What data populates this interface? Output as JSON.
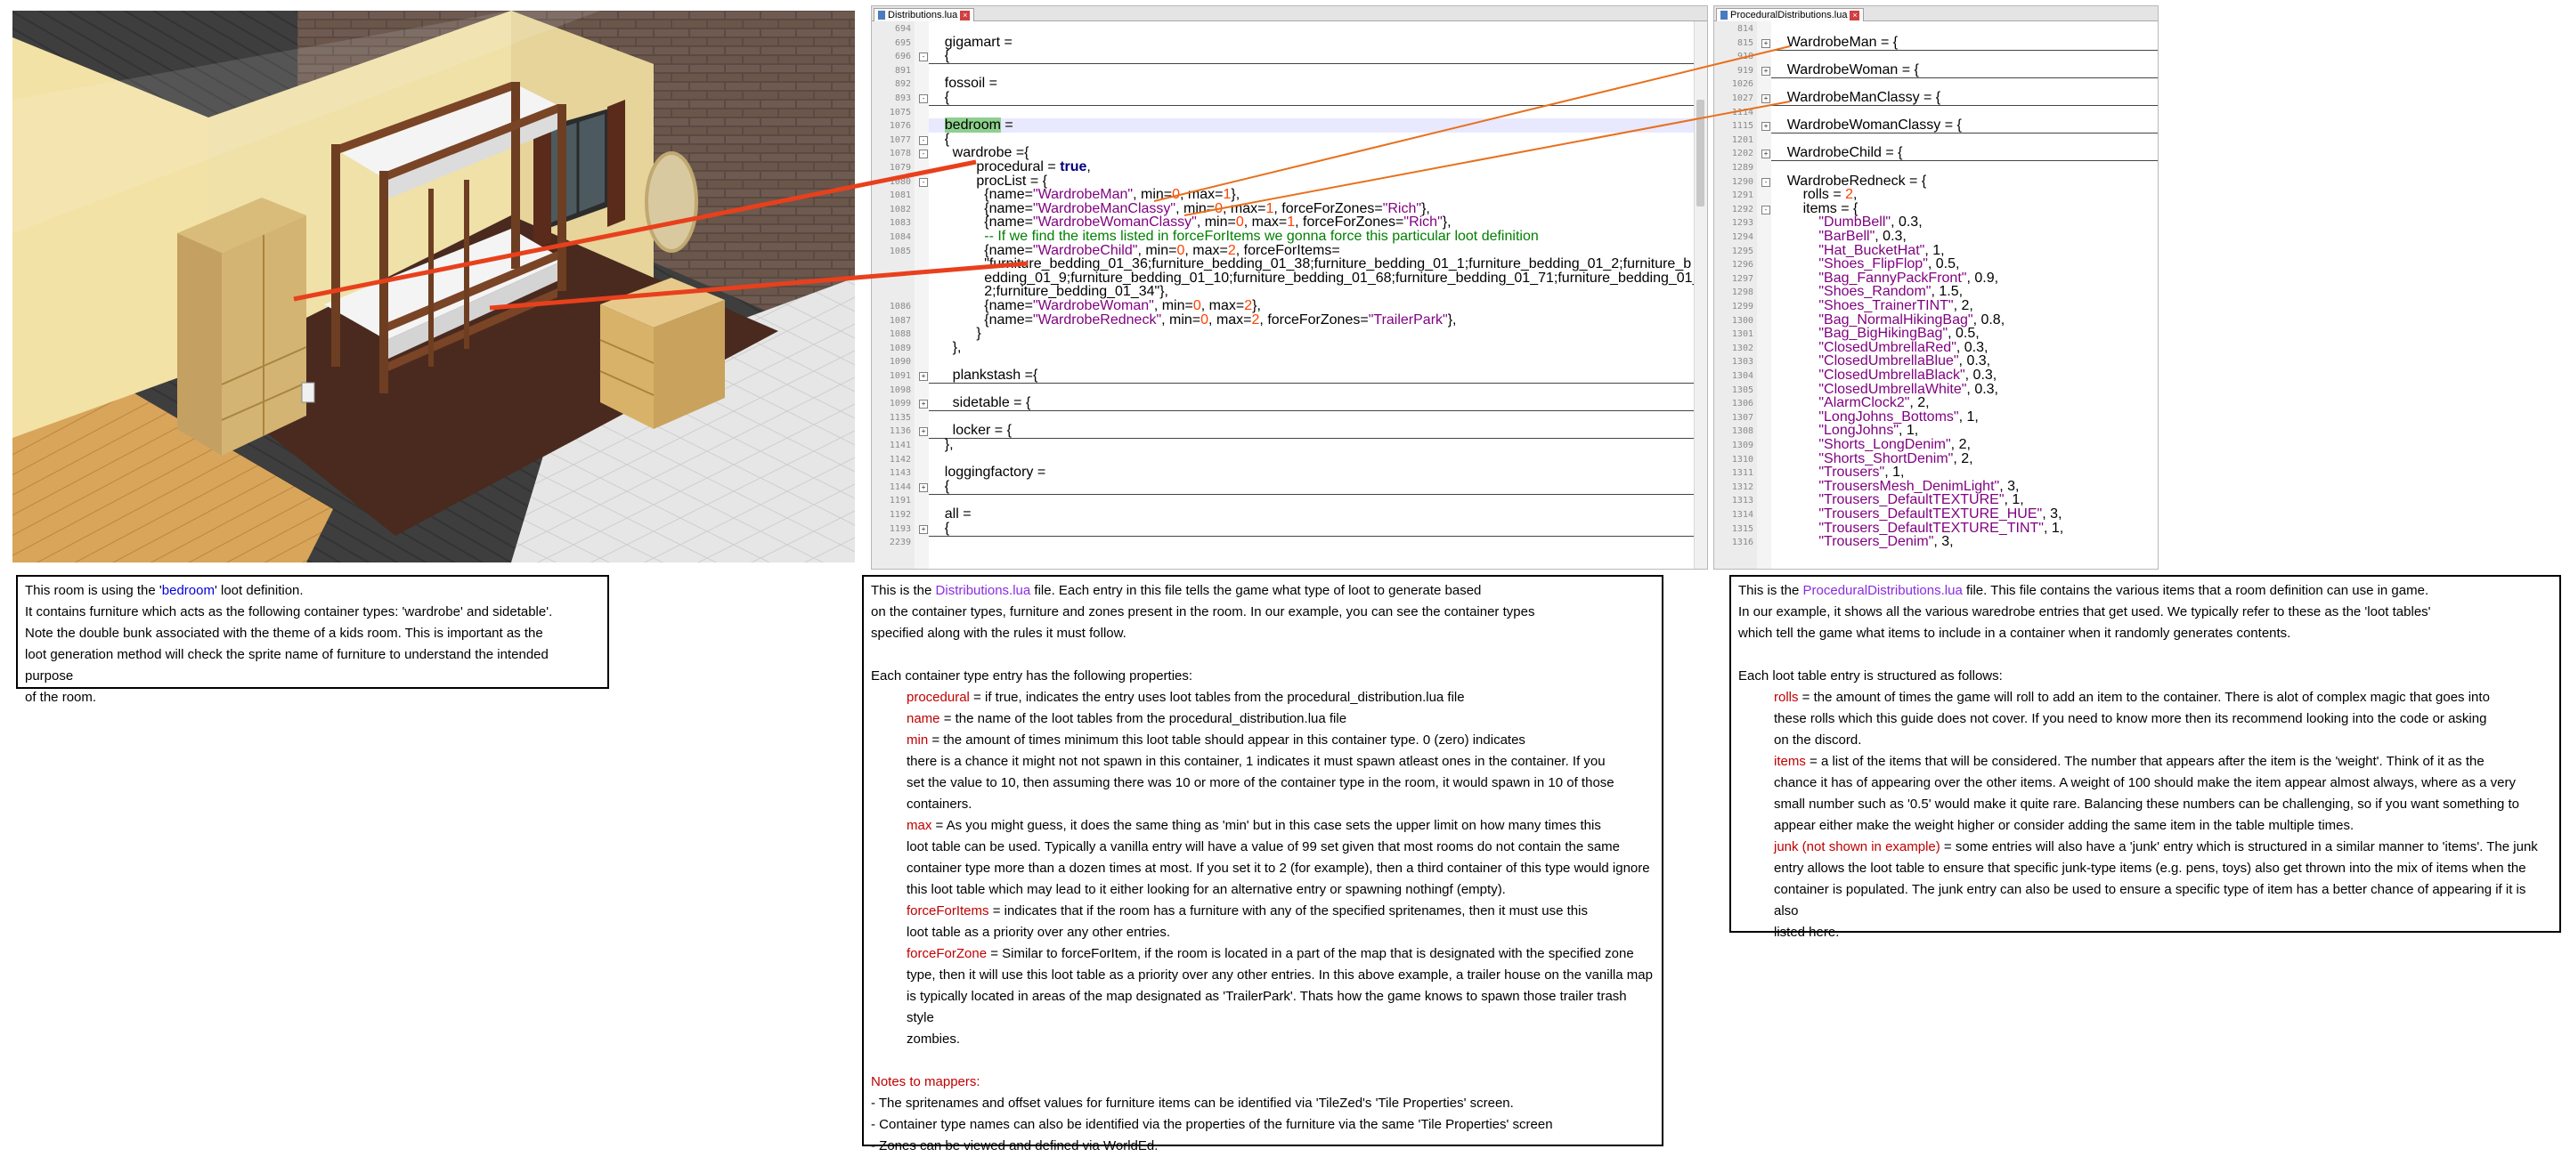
{
  "scene": {
    "name": "kids-bedroom-scene"
  },
  "editor_left": {
    "tab_label": "Distributions.lua",
    "lines": [
      {
        "n": "694",
        "t": ""
      },
      {
        "n": "695",
        "t": "    gigamart ="
      },
      {
        "n": "696",
        "t": "    {",
        "fold": "-",
        "ul": true
      },
      {
        "n": "891",
        "t": ""
      },
      {
        "n": "892",
        "t": "    fossoil ="
      },
      {
        "n": "893",
        "t": "    {",
        "fold": "-",
        "ul": true
      },
      {
        "n": "1075",
        "t": ""
      },
      {
        "n": "1076",
        "t": "    bedroom =",
        "hl": true
      },
      {
        "n": "1077",
        "t": "    {",
        "fold": "-"
      },
      {
        "n": "1078",
        "t": "      wardrobe ={",
        "fold": "-"
      },
      {
        "n": "1079",
        "t": "            procedural = true,"
      },
      {
        "n": "1080",
        "t": "            procList = {",
        "fold": "-"
      },
      {
        "n": "1081",
        "t": "              {name=\"WardrobeMan\", min=0, max=1},"
      },
      {
        "n": "1082",
        "t": "              {name=\"WardrobeManClassy\", min=0, max=1, forceForZones=\"Rich\"},"
      },
      {
        "n": "1083",
        "t": "              {name=\"WardrobeWomanClassy\", min=0, max=1, forceForZones=\"Rich\"},"
      },
      {
        "n": "1084",
        "t": "              -- If we find the items listed in forceForItems we gonna force this particular loot definition"
      },
      {
        "n": "1085",
        "t": "              {name=\"WardrobeChild\", min=0, max=2, forceForItems="
      },
      {
        "n": "",
        "t": "              \"furniture_bedding_01_36;furniture_bedding_01_38;furniture_bedding_01_1;furniture_bedding_01_2;furniture_b"
      },
      {
        "n": "",
        "t": "              edding_01_9;furniture_bedding_01_10;furniture_bedding_01_68;furniture_bedding_01_71;furniture_bedding_01_3"
      },
      {
        "n": "",
        "t": "              2;furniture_bedding_01_34\"},"
      },
      {
        "n": "1086",
        "t": "              {name=\"WardrobeWoman\", min=0, max=2},"
      },
      {
        "n": "1087",
        "t": "              {name=\"WardrobeRedneck\", min=0, max=2, forceForZones=\"TrailerPark\"},"
      },
      {
        "n": "1088",
        "t": "            }"
      },
      {
        "n": "1089",
        "t": "      },"
      },
      {
        "n": "1090",
        "t": ""
      },
      {
        "n": "1091",
        "t": "      plankstash ={",
        "fold": "+",
        "ul": true
      },
      {
        "n": "1098",
        "t": ""
      },
      {
        "n": "1099",
        "t": "      sidetable = {",
        "fold": "+",
        "ul": true
      },
      {
        "n": "1135",
        "t": ""
      },
      {
        "n": "1136",
        "t": "      locker = {",
        "fold": "+",
        "ul": true
      },
      {
        "n": "1141",
        "t": "    },"
      },
      {
        "n": "1142",
        "t": ""
      },
      {
        "n": "1143",
        "t": "    loggingfactory ="
      },
      {
        "n": "1144",
        "t": "    {",
        "fold": "+",
        "ul": true
      },
      {
        "n": "1191",
        "t": ""
      },
      {
        "n": "1192",
        "t": "    all ="
      },
      {
        "n": "1193",
        "t": "    {",
        "fold": "+",
        "ul": true
      },
      {
        "n": "2239",
        "t": ""
      }
    ]
  },
  "editor_right": {
    "tab_label": "ProceduralDistributions.lua",
    "lines": [
      {
        "n": "814",
        "t": ""
      },
      {
        "n": "815",
        "t": "    WardrobeMan = {",
        "fold": "+",
        "ul": true
      },
      {
        "n": "918",
        "t": ""
      },
      {
        "n": "919",
        "t": "    WardrobeWoman = {",
        "fold": "+",
        "ul": true
      },
      {
        "n": "1026",
        "t": ""
      },
      {
        "n": "1027",
        "t": "    WardrobeManClassy = {",
        "fold": "+",
        "ul": true
      },
      {
        "n": "1114",
        "t": ""
      },
      {
        "n": "1115",
        "t": "    WardrobeWomanClassy = {",
        "fold": "+",
        "ul": true
      },
      {
        "n": "1201",
        "t": ""
      },
      {
        "n": "1202",
        "t": "    WardrobeChild = {",
        "fold": "+",
        "ul": true
      },
      {
        "n": "1289",
        "t": ""
      },
      {
        "n": "1290",
        "t": "    WardrobeRedneck = {",
        "fold": "-"
      },
      {
        "n": "1291",
        "t": "        rolls = 2,"
      },
      {
        "n": "1292",
        "t": "        items = {",
        "fold": "-"
      },
      {
        "n": "1293",
        "t": "            \"DumbBell\", 0.3,"
      },
      {
        "n": "1294",
        "t": "            \"BarBell\", 0.3,"
      },
      {
        "n": "1295",
        "t": "            \"Hat_BucketHat\", 1,"
      },
      {
        "n": "1296",
        "t": "            \"Shoes_FlipFlop\", 0.5,"
      },
      {
        "n": "1297",
        "t": "            \"Bag_FannyPackFront\", 0.9,"
      },
      {
        "n": "1298",
        "t": "            \"Shoes_Random\", 1.5,"
      },
      {
        "n": "1299",
        "t": "            \"Shoes_TrainerTINT\", 2,"
      },
      {
        "n": "1300",
        "t": "            \"Bag_NormalHikingBag\", 0.8,"
      },
      {
        "n": "1301",
        "t": "            \"Bag_BigHikingBag\", 0.5,"
      },
      {
        "n": "1302",
        "t": "            \"ClosedUmbrellaRed\", 0.3,"
      },
      {
        "n": "1303",
        "t": "            \"ClosedUmbrellaBlue\", 0.3,"
      },
      {
        "n": "1304",
        "t": "            \"ClosedUmbrellaBlack\", 0.3,"
      },
      {
        "n": "1305",
        "t": "            \"ClosedUmbrellaWhite\", 0.3,"
      },
      {
        "n": "1306",
        "t": "            \"AlarmClock2\", 2,"
      },
      {
        "n": "1307",
        "t": "            \"LongJohns_Bottoms\", 1,"
      },
      {
        "n": "1308",
        "t": "            \"LongJohns\", 1,"
      },
      {
        "n": "1309",
        "t": "            \"Shorts_LongDenim\", 2,"
      },
      {
        "n": "1310",
        "t": "            \"Shorts_ShortDenim\", 2,"
      },
      {
        "n": "1311",
        "t": "            \"Trousers\", 1,"
      },
      {
        "n": "1312",
        "t": "            \"TrousersMesh_DenimLight\", 3,"
      },
      {
        "n": "1313",
        "t": "            \"Trousers_DefaultTEXTURE\", 1,"
      },
      {
        "n": "1314",
        "t": "            \"Trousers_DefaultTEXTURE_HUE\", 3,"
      },
      {
        "n": "1315",
        "t": "            \"Trousers_DefaultTEXTURE_TINT\", 1,"
      },
      {
        "n": "1316",
        "t": "            \"Trousers_Denim\", 3,"
      }
    ]
  },
  "box1": {
    "l1_pre": "This room is using the '",
    "l1_hl": "bedroom",
    "l1_post": "' loot definition.",
    "l2": "It contains furniture which acts as the following container types: 'wardrobe' and sidetable'.",
    "l3": "Note the double bunk associated with the theme of a kids room. This is important as the",
    "l4": "loot generation method will check the sprite name of furniture to understand the intended purpose",
    "l5": "of the room."
  },
  "box2": {
    "l1_pre": "This is the ",
    "l1_hl": "Distributions.lua",
    "l1_post": " file. Each entry in this file tells the game what type of loot to generate based",
    "l2": "on the container types, furniture and zones present in the room. In our example, you can see the container types",
    "l3": "specified along with the rules it must follow.",
    "l4": "Each  container type entry has the following properties:",
    "p_procedural_k": "procedural",
    "p_procedural_v": " = if true, indicates the entry uses loot tables from the procedural_distribution.lua file",
    "p_name_k": "name",
    "p_name_v": " = the name of the loot tables from the procedural_distribution.lua file",
    "p_min_k": "min",
    "p_min_v": " = the amount of times minimum this loot table should appear in this container type.  0 (zero) indicates",
    "p_min_2": "there is a chance it might not not spawn in this container, 1 indicates it must spawn atleast ones in the container. If you",
    "p_min_3": "set the value to 10, then assuming there was 10 or more of the container type in the room, it would spawn in 10 of those",
    "p_min_4": "containers.",
    "p_max_k": "max",
    "p_max_v": " = As you might guess, it does the same thing as 'min' but in this case sets the upper limit on how many times this",
    "p_max_2": "loot table can be used. Typically a vanilla entry will have a value of 99 set given that most rooms do not contain the same",
    "p_max_3": "container type more than a dozen times at most. If you set it to 2 (for example), then a third container of this type would ignore",
    "p_max_4": "this loot table which may lead to it either looking for an alternative entry or spawning nothingf (empty).",
    "p_ffi_k": "forceForItems",
    "p_ffi_v": " = indicates that if the room has a furniture with any of the specified spritenames, then it must use this",
    "p_ffi_2": "loot table as a priority over any other entries.",
    "p_ffz_k": "forceForZone",
    "p_ffz_v": " = Similar to forceForItem, if the room is located in a part of the map that is designated with the specified zone",
    "p_ffz_2": "type, then it will use this loot table as a priority over any other entries. In this above example, a trailer house on the vanilla map",
    "p_ffz_3": "is typically located in areas of the map designated as 'TrailerPark'. Thats how the game knows to spawn those trailer trash style",
    "p_ffz_4": "zombies.",
    "notes_title": "Notes to mappers:",
    "n1": "- The spritenames and offset values for furniture items can be identified via 'TileZed's 'Tile Properties' screen.",
    "n2": "- Container type names can also be identified via the properties of the furniture via the same 'Tile Properties' screen",
    "n3": "- Zones can be viewed and defined via WorldEd."
  },
  "box3": {
    "l1_pre": "This is the  ",
    "l1_hl": "ProceduralDistributions.lua",
    "l1_post": " file. This file contains the various items that a room definition can use in game.",
    "l2": "In our example, it shows all the various waredrobe entries that get used. We typically refer to these as the 'loot tables'",
    "l3": "which tell the game what items to include in a container when it randomly generates contents.",
    "l4": "Each loot table entry is structured as follows:",
    "rolls_k": "rolls",
    "rolls_v": " = the amount of times the game will roll to add an item to the container. There is alot of complex magic that goes into",
    "rolls_2": "these rolls which this guide does not cover. If you need to know more then its recommend looking into the code or asking",
    "rolls_3": "on the discord.",
    "items_k": "items",
    "items_v": " = a list of the items that will be considered. The number that appears after the item is the 'weight'. Think of it as the",
    "items_2": "chance it has of appearing over the other items. A weight of 100 should make the item appear almost always, where as a very",
    "items_3": "small number such as '0.5' would make it quite rare. Balancing these numbers can be challenging, so if you want something to",
    "items_4": "appear either make the weight higher or consider adding the same item in the table multiple times.",
    "junk_k": "junk (not shown in example)",
    "junk_v": " = some entries will also have a 'junk' entry which is structured in a similar manner to 'items'. The junk",
    "junk_2": "entry allows the loot table to ensure that specific junk-type items (e.g. pens, toys) also get thrown into the mix of items when the",
    "junk_3": "container is populated. The junk entry can also be used to ensure a specific type of item has a better chance of appearing if it is also",
    "junk_4": "listed here."
  }
}
